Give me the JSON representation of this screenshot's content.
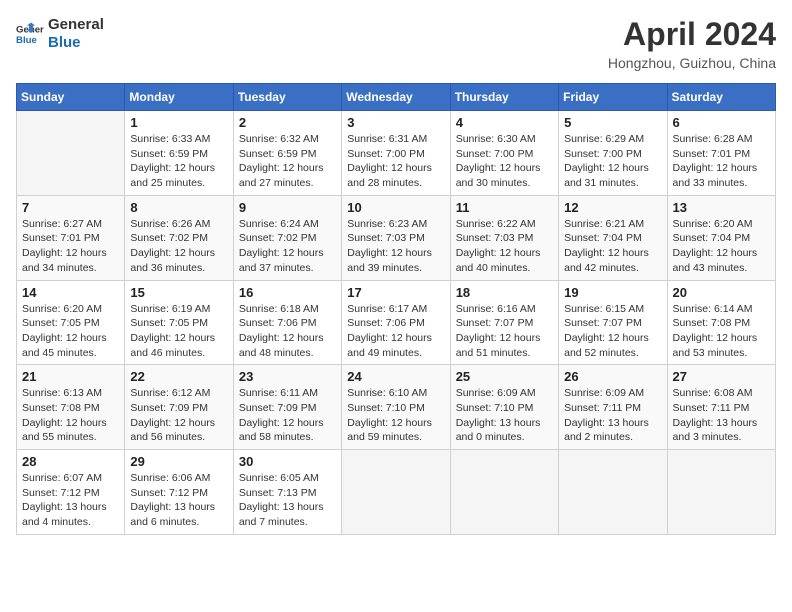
{
  "header": {
    "logo_line1": "General",
    "logo_line2": "Blue",
    "month_title": "April 2024",
    "location": "Hongzhou, Guizhou, China"
  },
  "weekdays": [
    "Sunday",
    "Monday",
    "Tuesday",
    "Wednesday",
    "Thursday",
    "Friday",
    "Saturday"
  ],
  "weeks": [
    [
      {
        "day": "",
        "info": ""
      },
      {
        "day": "1",
        "info": "Sunrise: 6:33 AM\nSunset: 6:59 PM\nDaylight: 12 hours\nand 25 minutes."
      },
      {
        "day": "2",
        "info": "Sunrise: 6:32 AM\nSunset: 6:59 PM\nDaylight: 12 hours\nand 27 minutes."
      },
      {
        "day": "3",
        "info": "Sunrise: 6:31 AM\nSunset: 7:00 PM\nDaylight: 12 hours\nand 28 minutes."
      },
      {
        "day": "4",
        "info": "Sunrise: 6:30 AM\nSunset: 7:00 PM\nDaylight: 12 hours\nand 30 minutes."
      },
      {
        "day": "5",
        "info": "Sunrise: 6:29 AM\nSunset: 7:00 PM\nDaylight: 12 hours\nand 31 minutes."
      },
      {
        "day": "6",
        "info": "Sunrise: 6:28 AM\nSunset: 7:01 PM\nDaylight: 12 hours\nand 33 minutes."
      }
    ],
    [
      {
        "day": "7",
        "info": "Sunrise: 6:27 AM\nSunset: 7:01 PM\nDaylight: 12 hours\nand 34 minutes."
      },
      {
        "day": "8",
        "info": "Sunrise: 6:26 AM\nSunset: 7:02 PM\nDaylight: 12 hours\nand 36 minutes."
      },
      {
        "day": "9",
        "info": "Sunrise: 6:24 AM\nSunset: 7:02 PM\nDaylight: 12 hours\nand 37 minutes."
      },
      {
        "day": "10",
        "info": "Sunrise: 6:23 AM\nSunset: 7:03 PM\nDaylight: 12 hours\nand 39 minutes."
      },
      {
        "day": "11",
        "info": "Sunrise: 6:22 AM\nSunset: 7:03 PM\nDaylight: 12 hours\nand 40 minutes."
      },
      {
        "day": "12",
        "info": "Sunrise: 6:21 AM\nSunset: 7:04 PM\nDaylight: 12 hours\nand 42 minutes."
      },
      {
        "day": "13",
        "info": "Sunrise: 6:20 AM\nSunset: 7:04 PM\nDaylight: 12 hours\nand 43 minutes."
      }
    ],
    [
      {
        "day": "14",
        "info": "Sunrise: 6:20 AM\nSunset: 7:05 PM\nDaylight: 12 hours\nand 45 minutes."
      },
      {
        "day": "15",
        "info": "Sunrise: 6:19 AM\nSunset: 7:05 PM\nDaylight: 12 hours\nand 46 minutes."
      },
      {
        "day": "16",
        "info": "Sunrise: 6:18 AM\nSunset: 7:06 PM\nDaylight: 12 hours\nand 48 minutes."
      },
      {
        "day": "17",
        "info": "Sunrise: 6:17 AM\nSunset: 7:06 PM\nDaylight: 12 hours\nand 49 minutes."
      },
      {
        "day": "18",
        "info": "Sunrise: 6:16 AM\nSunset: 7:07 PM\nDaylight: 12 hours\nand 51 minutes."
      },
      {
        "day": "19",
        "info": "Sunrise: 6:15 AM\nSunset: 7:07 PM\nDaylight: 12 hours\nand 52 minutes."
      },
      {
        "day": "20",
        "info": "Sunrise: 6:14 AM\nSunset: 7:08 PM\nDaylight: 12 hours\nand 53 minutes."
      }
    ],
    [
      {
        "day": "21",
        "info": "Sunrise: 6:13 AM\nSunset: 7:08 PM\nDaylight: 12 hours\nand 55 minutes."
      },
      {
        "day": "22",
        "info": "Sunrise: 6:12 AM\nSunset: 7:09 PM\nDaylight: 12 hours\nand 56 minutes."
      },
      {
        "day": "23",
        "info": "Sunrise: 6:11 AM\nSunset: 7:09 PM\nDaylight: 12 hours\nand 58 minutes."
      },
      {
        "day": "24",
        "info": "Sunrise: 6:10 AM\nSunset: 7:10 PM\nDaylight: 12 hours\nand 59 minutes."
      },
      {
        "day": "25",
        "info": "Sunrise: 6:09 AM\nSunset: 7:10 PM\nDaylight: 13 hours\nand 0 minutes."
      },
      {
        "day": "26",
        "info": "Sunrise: 6:09 AM\nSunset: 7:11 PM\nDaylight: 13 hours\nand 2 minutes."
      },
      {
        "day": "27",
        "info": "Sunrise: 6:08 AM\nSunset: 7:11 PM\nDaylight: 13 hours\nand 3 minutes."
      }
    ],
    [
      {
        "day": "28",
        "info": "Sunrise: 6:07 AM\nSunset: 7:12 PM\nDaylight: 13 hours\nand 4 minutes."
      },
      {
        "day": "29",
        "info": "Sunrise: 6:06 AM\nSunset: 7:12 PM\nDaylight: 13 hours\nand 6 minutes."
      },
      {
        "day": "30",
        "info": "Sunrise: 6:05 AM\nSunset: 7:13 PM\nDaylight: 13 hours\nand 7 minutes."
      },
      {
        "day": "",
        "info": ""
      },
      {
        "day": "",
        "info": ""
      },
      {
        "day": "",
        "info": ""
      },
      {
        "day": "",
        "info": ""
      }
    ]
  ]
}
